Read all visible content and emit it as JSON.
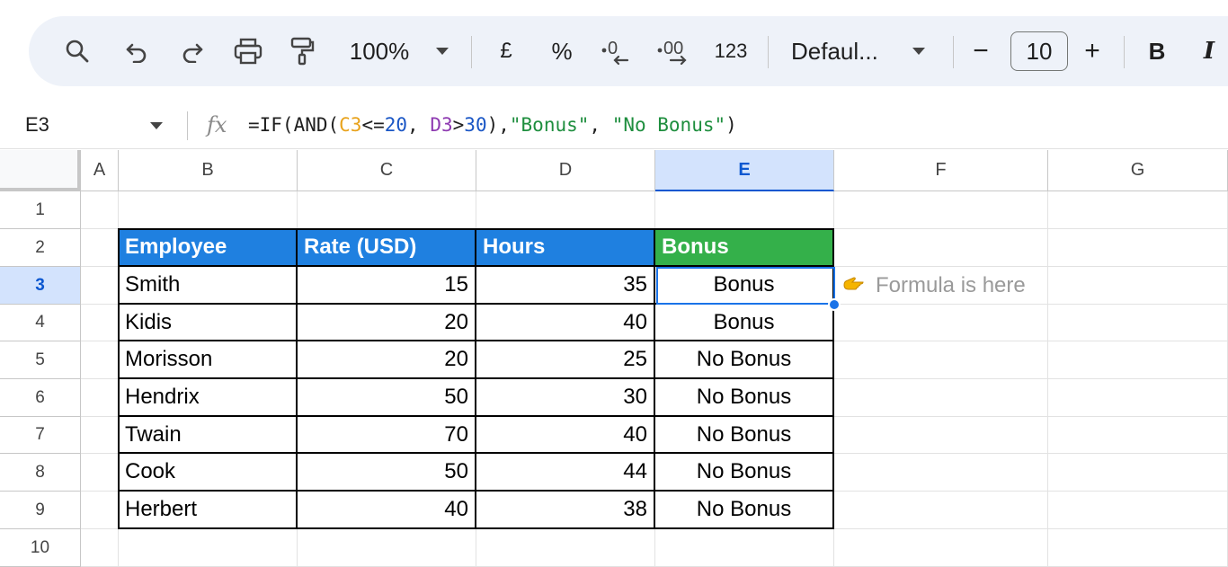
{
  "toolbar": {
    "zoom": "100%",
    "currency": "£",
    "percent": "%",
    "number_format": "123",
    "font": "Defaul...",
    "minus": "−",
    "font_size": "10",
    "plus": "+",
    "bold": "B",
    "italic": "I"
  },
  "formula_bar": {
    "cell_ref": "E3",
    "fx": "fx",
    "formula": {
      "p1": "=IF(AND(",
      "c3": "C3",
      "p2": "<=",
      "n20": "20",
      "p3": ", ",
      "d3": "D3",
      "p4": ">",
      "n30": "30",
      "p5": "),",
      "s1": "\"Bonus\"",
      "p6": ", ",
      "s2": "\"No Bonus\"",
      "p7": ")"
    }
  },
  "grid": {
    "columns": [
      "A",
      "B",
      "C",
      "D",
      "E",
      "F",
      "G"
    ],
    "rows": [
      "1",
      "2",
      "3",
      "4",
      "5",
      "6",
      "7",
      "8",
      "9",
      "10"
    ],
    "active_column": "E",
    "active_row": "3"
  },
  "table": {
    "headers": [
      "Employee",
      "Rate (USD)",
      "Hours",
      "Bonus"
    ],
    "rows": [
      [
        "Smith",
        "15",
        "35",
        "Bonus"
      ],
      [
        "Kidis",
        "20",
        "40",
        "Bonus"
      ],
      [
        "Morisson",
        "20",
        "25",
        "No Bonus"
      ],
      [
        "Hendrix",
        "50",
        "30",
        "No Bonus"
      ],
      [
        "Twain",
        "70",
        "40",
        "No Bonus"
      ],
      [
        "Cook",
        "50",
        "44",
        "No Bonus"
      ],
      [
        "Herbert",
        "40",
        "38",
        "No Bonus"
      ]
    ]
  },
  "note": {
    "icon": "pointing-hand-icon",
    "text": "Formula is here"
  },
  "colors": {
    "header_blue": "#1f80e0",
    "header_green": "#34b04a",
    "selection": "#1a73e8"
  }
}
